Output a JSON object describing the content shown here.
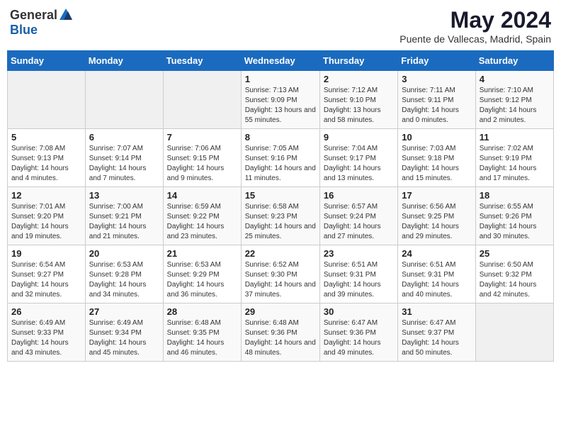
{
  "header": {
    "logo_general": "General",
    "logo_blue": "Blue",
    "title": "May 2024",
    "subtitle": "Puente de Vallecas, Madrid, Spain"
  },
  "days_of_week": [
    "Sunday",
    "Monday",
    "Tuesday",
    "Wednesday",
    "Thursday",
    "Friday",
    "Saturday"
  ],
  "weeks": [
    [
      {
        "num": "",
        "sunrise": "",
        "sunset": "",
        "daylight": "",
        "empty": true
      },
      {
        "num": "",
        "sunrise": "",
        "sunset": "",
        "daylight": "",
        "empty": true
      },
      {
        "num": "",
        "sunrise": "",
        "sunset": "",
        "daylight": "",
        "empty": true
      },
      {
        "num": "1",
        "sunrise": "Sunrise: 7:13 AM",
        "sunset": "Sunset: 9:09 PM",
        "daylight": "Daylight: 13 hours and 55 minutes.",
        "empty": false
      },
      {
        "num": "2",
        "sunrise": "Sunrise: 7:12 AM",
        "sunset": "Sunset: 9:10 PM",
        "daylight": "Daylight: 13 hours and 58 minutes.",
        "empty": false
      },
      {
        "num": "3",
        "sunrise": "Sunrise: 7:11 AM",
        "sunset": "Sunset: 9:11 PM",
        "daylight": "Daylight: 14 hours and 0 minutes.",
        "empty": false
      },
      {
        "num": "4",
        "sunrise": "Sunrise: 7:10 AM",
        "sunset": "Sunset: 9:12 PM",
        "daylight": "Daylight: 14 hours and 2 minutes.",
        "empty": false
      }
    ],
    [
      {
        "num": "5",
        "sunrise": "Sunrise: 7:08 AM",
        "sunset": "Sunset: 9:13 PM",
        "daylight": "Daylight: 14 hours and 4 minutes.",
        "empty": false
      },
      {
        "num": "6",
        "sunrise": "Sunrise: 7:07 AM",
        "sunset": "Sunset: 9:14 PM",
        "daylight": "Daylight: 14 hours and 7 minutes.",
        "empty": false
      },
      {
        "num": "7",
        "sunrise": "Sunrise: 7:06 AM",
        "sunset": "Sunset: 9:15 PM",
        "daylight": "Daylight: 14 hours and 9 minutes.",
        "empty": false
      },
      {
        "num": "8",
        "sunrise": "Sunrise: 7:05 AM",
        "sunset": "Sunset: 9:16 PM",
        "daylight": "Daylight: 14 hours and 11 minutes.",
        "empty": false
      },
      {
        "num": "9",
        "sunrise": "Sunrise: 7:04 AM",
        "sunset": "Sunset: 9:17 PM",
        "daylight": "Daylight: 14 hours and 13 minutes.",
        "empty": false
      },
      {
        "num": "10",
        "sunrise": "Sunrise: 7:03 AM",
        "sunset": "Sunset: 9:18 PM",
        "daylight": "Daylight: 14 hours and 15 minutes.",
        "empty": false
      },
      {
        "num": "11",
        "sunrise": "Sunrise: 7:02 AM",
        "sunset": "Sunset: 9:19 PM",
        "daylight": "Daylight: 14 hours and 17 minutes.",
        "empty": false
      }
    ],
    [
      {
        "num": "12",
        "sunrise": "Sunrise: 7:01 AM",
        "sunset": "Sunset: 9:20 PM",
        "daylight": "Daylight: 14 hours and 19 minutes.",
        "empty": false
      },
      {
        "num": "13",
        "sunrise": "Sunrise: 7:00 AM",
        "sunset": "Sunset: 9:21 PM",
        "daylight": "Daylight: 14 hours and 21 minutes.",
        "empty": false
      },
      {
        "num": "14",
        "sunrise": "Sunrise: 6:59 AM",
        "sunset": "Sunset: 9:22 PM",
        "daylight": "Daylight: 14 hours and 23 minutes.",
        "empty": false
      },
      {
        "num": "15",
        "sunrise": "Sunrise: 6:58 AM",
        "sunset": "Sunset: 9:23 PM",
        "daylight": "Daylight: 14 hours and 25 minutes.",
        "empty": false
      },
      {
        "num": "16",
        "sunrise": "Sunrise: 6:57 AM",
        "sunset": "Sunset: 9:24 PM",
        "daylight": "Daylight: 14 hours and 27 minutes.",
        "empty": false
      },
      {
        "num": "17",
        "sunrise": "Sunrise: 6:56 AM",
        "sunset": "Sunset: 9:25 PM",
        "daylight": "Daylight: 14 hours and 29 minutes.",
        "empty": false
      },
      {
        "num": "18",
        "sunrise": "Sunrise: 6:55 AM",
        "sunset": "Sunset: 9:26 PM",
        "daylight": "Daylight: 14 hours and 30 minutes.",
        "empty": false
      }
    ],
    [
      {
        "num": "19",
        "sunrise": "Sunrise: 6:54 AM",
        "sunset": "Sunset: 9:27 PM",
        "daylight": "Daylight: 14 hours and 32 minutes.",
        "empty": false
      },
      {
        "num": "20",
        "sunrise": "Sunrise: 6:53 AM",
        "sunset": "Sunset: 9:28 PM",
        "daylight": "Daylight: 14 hours and 34 minutes.",
        "empty": false
      },
      {
        "num": "21",
        "sunrise": "Sunrise: 6:53 AM",
        "sunset": "Sunset: 9:29 PM",
        "daylight": "Daylight: 14 hours and 36 minutes.",
        "empty": false
      },
      {
        "num": "22",
        "sunrise": "Sunrise: 6:52 AM",
        "sunset": "Sunset: 9:30 PM",
        "daylight": "Daylight: 14 hours and 37 minutes.",
        "empty": false
      },
      {
        "num": "23",
        "sunrise": "Sunrise: 6:51 AM",
        "sunset": "Sunset: 9:31 PM",
        "daylight": "Daylight: 14 hours and 39 minutes.",
        "empty": false
      },
      {
        "num": "24",
        "sunrise": "Sunrise: 6:51 AM",
        "sunset": "Sunset: 9:31 PM",
        "daylight": "Daylight: 14 hours and 40 minutes.",
        "empty": false
      },
      {
        "num": "25",
        "sunrise": "Sunrise: 6:50 AM",
        "sunset": "Sunset: 9:32 PM",
        "daylight": "Daylight: 14 hours and 42 minutes.",
        "empty": false
      }
    ],
    [
      {
        "num": "26",
        "sunrise": "Sunrise: 6:49 AM",
        "sunset": "Sunset: 9:33 PM",
        "daylight": "Daylight: 14 hours and 43 minutes.",
        "empty": false
      },
      {
        "num": "27",
        "sunrise": "Sunrise: 6:49 AM",
        "sunset": "Sunset: 9:34 PM",
        "daylight": "Daylight: 14 hours and 45 minutes.",
        "empty": false
      },
      {
        "num": "28",
        "sunrise": "Sunrise: 6:48 AM",
        "sunset": "Sunset: 9:35 PM",
        "daylight": "Daylight: 14 hours and 46 minutes.",
        "empty": false
      },
      {
        "num": "29",
        "sunrise": "Sunrise: 6:48 AM",
        "sunset": "Sunset: 9:36 PM",
        "daylight": "Daylight: 14 hours and 48 minutes.",
        "empty": false
      },
      {
        "num": "30",
        "sunrise": "Sunrise: 6:47 AM",
        "sunset": "Sunset: 9:36 PM",
        "daylight": "Daylight: 14 hours and 49 minutes.",
        "empty": false
      },
      {
        "num": "31",
        "sunrise": "Sunrise: 6:47 AM",
        "sunset": "Sunset: 9:37 PM",
        "daylight": "Daylight: 14 hours and 50 minutes.",
        "empty": false
      },
      {
        "num": "",
        "sunrise": "",
        "sunset": "",
        "daylight": "",
        "empty": true
      }
    ]
  ]
}
